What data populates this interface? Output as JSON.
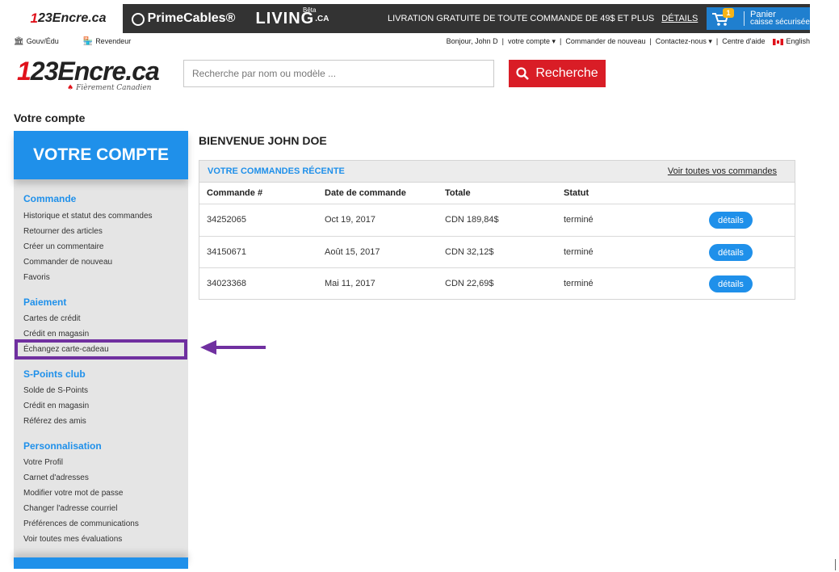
{
  "topbar": {
    "brand_123": "23Encre.ca",
    "brand_123_num": "1",
    "brand_prime": "PrimeCables®",
    "brand_living": "LIVING",
    "brand_living_ca": ".CA",
    "brand_living_beta": "Bêta",
    "shipping_text": "LIVRATION GRATUITE DE TOUTE COMMANDE DE 49$ ET PLUS",
    "shipping_link": "DÉTAILS",
    "cart_count": "1",
    "cart_label": "Panier",
    "cart_sub": "caisse sécurisée"
  },
  "subbar": {
    "gov": "Gouv/Édu",
    "reseller": "Revendeur",
    "greeting": "Bonjour, John D",
    "account": "votre compte ▾",
    "reorder": "Commander de nouveau",
    "contact": "Contactez-nous ▾",
    "help": "Centre d'aide",
    "language": "English"
  },
  "logo": {
    "num": "1",
    "rest": "23Encre.ca",
    "tagline": "Fièrement Canadien"
  },
  "search": {
    "placeholder": "Recherche par nom ou modèle ...",
    "button_label": "Recherche"
  },
  "page_title": "Votre compte",
  "sidebar": {
    "header": "VOTRE COMPTE",
    "sections": [
      {
        "title": "Commande",
        "items": [
          "Historique et statut des commandes",
          "Retourner des articles",
          "Créer un commentaire",
          "Commander de nouveau",
          "Favoris"
        ]
      },
      {
        "title": "Paiement",
        "items": [
          "Cartes de crédit",
          "Crédit en magasin",
          "Échangez carte-cadeau"
        ]
      },
      {
        "title": "S-Points club",
        "items": [
          "Solde de S-Points",
          "Crédit en magasin",
          "Référez des amis"
        ]
      },
      {
        "title": "Personnalisation",
        "items": [
          "Votre Profil",
          "Carnet d'adresses",
          "Modifier votre mot de passe",
          "Changer l'adresse courriel",
          "Préférences de communications",
          "Voir toutes mes évaluations"
        ]
      }
    ]
  },
  "main": {
    "welcome": "BIENVENUE JOHN DOE",
    "orders_title": "VOTRE COMMANDES RÉCENTE",
    "view_all": "Voir toutes vos commandes",
    "columns": [
      "Commande #",
      "Date de commande",
      "Totale",
      "Statut"
    ],
    "details_label": "détails",
    "rows": [
      {
        "order": "34252065",
        "date": "Oct 19, 2017",
        "total": "CDN 189,84$",
        "status": "terminé"
      },
      {
        "order": "34150671",
        "date": "Août 15, 2017",
        "total": "CDN 32,12$",
        "status": "terminé"
      },
      {
        "order": "34023368",
        "date": "Mai 11, 2017",
        "total": "CDN 22,69$",
        "status": "terminé"
      }
    ]
  },
  "colors": {
    "accent_blue": "#1f90ea",
    "brand_red": "#d91d26",
    "highlight_purple": "#7030a0",
    "topbar_dark": "#333333"
  }
}
